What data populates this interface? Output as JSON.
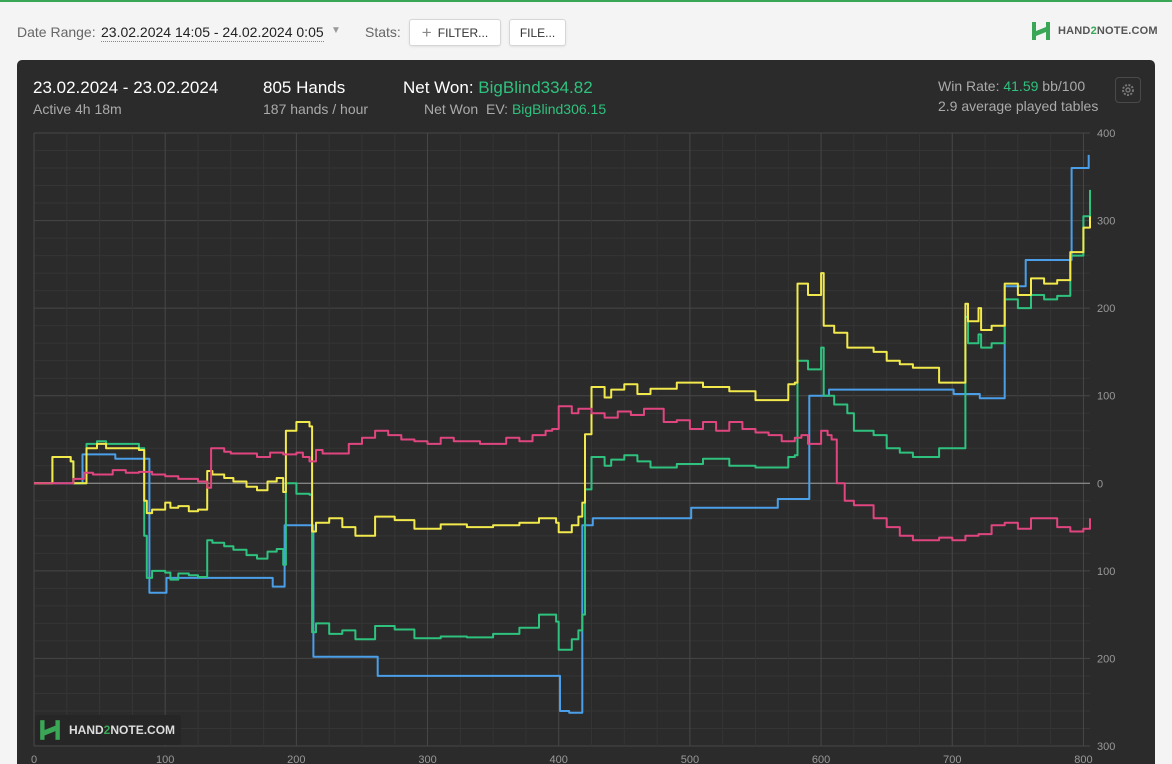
{
  "toolbar": {
    "date_range_label": "Date Range:",
    "date_range_value": "23.02.2024 14:05 - 24.02.2024 0:05",
    "stats_label": "Stats:",
    "filter_button": "FILTER...",
    "file_button": "FILE...",
    "brand_prefix": "HAND",
    "brand_two": "2",
    "brand_suffix": "NOTE.COM"
  },
  "summary": {
    "dates": "23.02.2024 - 23.02.2024",
    "active": "Active 4h 18m",
    "hands": "805 Hands",
    "hands_per_hour": "187 hands / hour",
    "net_won_label": "Net Won: ",
    "net_won_value": "BigBlind334.82",
    "net_won_ev_label": "Net Won  EV: ",
    "net_won_ev_value": "BigBlind306.15",
    "win_rate_label": "Win Rate: ",
    "win_rate_value": "41.59",
    "win_rate_unit": " bb/100",
    "avg_tables": "2.9 average played tables"
  },
  "colors": {
    "blue": "#4a9fe8",
    "green": "#2ec27e",
    "yellow": "#f2ea4c",
    "pink": "#e0457f",
    "panel_bg": "#2b2b2b",
    "brand_green": "#3aa757"
  },
  "chart_data": {
    "type": "line",
    "xlim": [
      0,
      805
    ],
    "ylim": [
      -300,
      400
    ],
    "x_ticks": [
      0,
      100,
      200,
      300,
      400,
      500,
      600,
      700,
      800
    ],
    "y_ticks": [
      {
        "value": 400,
        "label": "400"
      },
      {
        "value": 300,
        "label": "300"
      },
      {
        "value": 200,
        "label": "200"
      },
      {
        "value": 100,
        "label": "100"
      },
      {
        "value": 0,
        "label": "0"
      },
      {
        "value": -100,
        "label": "100"
      },
      {
        "value": -200,
        "label": "200"
      },
      {
        "value": -300,
        "label": "300"
      }
    ],
    "grid": true,
    "series": [
      {
        "color": "blue",
        "x": [
          0,
          35,
          37,
          60,
          62,
          87,
          88,
          100,
          101,
          180,
          182,
          190,
          191,
          212,
          213,
          260,
          262,
          400,
          401,
          407,
          408,
          417,
          418,
          425,
          426,
          500,
          501,
          565,
          567,
          590,
          591,
          605,
          606,
          700,
          701,
          720,
          721,
          738,
          740,
          755,
          756,
          790,
          791,
          803,
          804
        ],
        "y": [
          0,
          0,
          33,
          33,
          28,
          28,
          -125,
          -125,
          -108,
          -108,
          -118,
          -118,
          -48,
          -48,
          -198,
          -198,
          -220,
          -220,
          -260,
          -260,
          -262,
          -262,
          -48,
          -48,
          -40,
          -40,
          -28,
          -28,
          -18,
          -18,
          100,
          100,
          107,
          107,
          102,
          102,
          97,
          97,
          225,
          225,
          255,
          255,
          360,
          360,
          375
        ]
      },
      {
        "color": "green",
        "x": [
          0,
          8,
          14,
          28,
          30,
          40,
          48,
          55,
          80,
          84,
          86,
          90,
          100,
          104,
          110,
          118,
          125,
          132,
          136,
          145,
          152,
          162,
          170,
          178,
          185,
          190,
          192,
          200,
          210,
          212,
          215,
          225,
          235,
          245,
          260,
          275,
          290,
          310,
          330,
          350,
          370,
          385,
          398,
          400,
          410,
          415,
          418,
          420,
          425,
          435,
          440,
          450,
          460,
          470,
          490,
          510,
          530,
          550,
          575,
          580,
          582,
          590,
          600,
          602,
          610,
          620,
          625,
          640,
          650,
          660,
          670,
          690,
          700,
          710,
          712,
          720,
          722,
          730,
          740,
          750,
          760,
          770,
          780,
          790,
          800,
          805
        ],
        "y": [
          0,
          0,
          30,
          25,
          0,
          45,
          48,
          45,
          40,
          -60,
          -108,
          -100,
          -102,
          -110,
          -103,
          -105,
          -107,
          -65,
          -68,
          -72,
          -76,
          -82,
          -86,
          -78,
          -75,
          -93,
          0,
          -12,
          -13,
          -170,
          -160,
          -172,
          -168,
          -178,
          -163,
          -167,
          -177,
          -175,
          -176,
          -172,
          -165,
          -150,
          -158,
          -190,
          -178,
          -168,
          -150,
          -7,
          30,
          20,
          27,
          32,
          25,
          18,
          22,
          28,
          20,
          18,
          30,
          32,
          140,
          130,
          155,
          100,
          90,
          80,
          60,
          55,
          40,
          35,
          30,
          40,
          40,
          190,
          160,
          170,
          155,
          160,
          210,
          200,
          215,
          210,
          214,
          260,
          305,
          335
        ]
      },
      {
        "color": "yellow",
        "x": [
          0,
          8,
          14,
          28,
          30,
          40,
          48,
          55,
          80,
          84,
          86,
          90,
          100,
          104,
          110,
          118,
          125,
          132,
          136,
          145,
          152,
          162,
          170,
          178,
          185,
          190,
          192,
          200,
          210,
          212,
          215,
          225,
          235,
          245,
          260,
          275,
          290,
          310,
          330,
          350,
          370,
          385,
          398,
          400,
          410,
          415,
          418,
          420,
          425,
          435,
          440,
          450,
          460,
          470,
          490,
          510,
          530,
          550,
          575,
          580,
          582,
          590,
          600,
          602,
          610,
          620,
          625,
          640,
          650,
          660,
          670,
          690,
          700,
          710,
          712,
          720,
          722,
          730,
          740,
          750,
          760,
          770,
          780,
          790,
          800,
          805
        ],
        "y": [
          0,
          0,
          30,
          25,
          0,
          40,
          45,
          40,
          38,
          -20,
          -34,
          -30,
          -22,
          -28,
          -26,
          -32,
          -30,
          14,
          10,
          6,
          2,
          -4,
          -8,
          2,
          6,
          -10,
          60,
          70,
          65,
          -55,
          -45,
          -40,
          -50,
          -60,
          -38,
          -42,
          -52,
          -47,
          -50,
          -48,
          -45,
          -40,
          -45,
          -56,
          -48,
          -38,
          -22,
          56,
          110,
          98,
          107,
          113,
          102,
          108,
          115,
          110,
          105,
          95,
          113,
          115,
          228,
          215,
          240,
          180,
          172,
          155,
          155,
          150,
          140,
          136,
          132,
          115,
          115,
          205,
          185,
          200,
          175,
          180,
          228,
          215,
          234,
          228,
          232,
          264,
          292,
          305
        ]
      },
      {
        "color": "pink",
        "x": [
          0,
          30,
          38,
          45,
          60,
          70,
          80,
          90,
          100,
          110,
          125,
          132,
          135,
          145,
          150,
          170,
          180,
          190,
          200,
          205,
          210,
          215,
          220,
          240,
          250,
          260,
          270,
          280,
          290,
          300,
          310,
          320,
          340,
          360,
          370,
          380,
          390,
          395,
          400,
          410,
          415,
          420,
          425,
          435,
          445,
          455,
          465,
          480,
          490,
          500,
          510,
          520,
          530,
          540,
          550,
          560,
          570,
          580,
          585,
          590,
          600,
          605,
          608,
          612,
          618,
          625,
          640,
          650,
          660,
          670,
          680,
          690,
          700,
          710,
          720,
          730,
          740,
          750,
          760,
          770,
          780,
          790,
          800,
          805
        ],
        "y": [
          0,
          5,
          12,
          10,
          15,
          12,
          13,
          10,
          8,
          5,
          2,
          -5,
          40,
          36,
          34,
          30,
          35,
          33,
          35,
          30,
          25,
          38,
          34,
          45,
          52,
          60,
          55,
          50,
          48,
          45,
          52,
          48,
          45,
          52,
          48,
          55,
          60,
          62,
          88,
          80,
          85,
          85,
          80,
          75,
          82,
          78,
          85,
          70,
          72,
          62,
          70,
          60,
          70,
          62,
          58,
          55,
          48,
          52,
          55,
          45,
          60,
          55,
          50,
          0,
          -20,
          -25,
          -40,
          -50,
          -60,
          -65,
          -65,
          -62,
          -65,
          -60,
          -58,
          -48,
          -45,
          -52,
          -40,
          -40,
          -50,
          -55,
          -52,
          -40
        ]
      }
    ]
  }
}
